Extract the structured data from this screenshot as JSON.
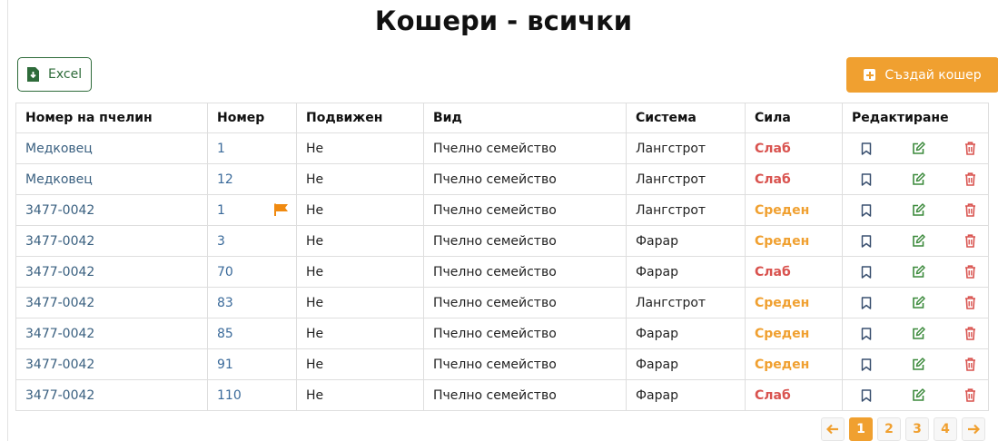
{
  "page": {
    "title": "Кошери - всички"
  },
  "toolbar": {
    "excel_label": "Excel",
    "create_label": "Създай кошер"
  },
  "table": {
    "headers": [
      "Номер на пчелин",
      "Номер",
      "Подвижен",
      "Вид",
      "Система",
      "Сила",
      "Редактиране"
    ],
    "rows": [
      {
        "apiary": "Медковец",
        "number": "1",
        "flag": false,
        "mobile": "Не",
        "type": "Пчелно семейство",
        "system": "Лангстрот",
        "strength": "Слаб",
        "level": "weak"
      },
      {
        "apiary": "Медковец",
        "number": "12",
        "flag": false,
        "mobile": "Не",
        "type": "Пчелно семейство",
        "system": "Лангстрот",
        "strength": "Слаб",
        "level": "weak"
      },
      {
        "apiary": "3477-0042",
        "number": "1",
        "flag": true,
        "mobile": "Не",
        "type": "Пчелно семейство",
        "system": "Лангстрот",
        "strength": "Среден",
        "level": "mid"
      },
      {
        "apiary": "3477-0042",
        "number": "3",
        "flag": false,
        "mobile": "Не",
        "type": "Пчелно семейство",
        "system": "Фарар",
        "strength": "Среден",
        "level": "mid"
      },
      {
        "apiary": "3477-0042",
        "number": "70",
        "flag": false,
        "mobile": "Не",
        "type": "Пчелно семейство",
        "system": "Фарар",
        "strength": "Слаб",
        "level": "weak"
      },
      {
        "apiary": "3477-0042",
        "number": "83",
        "flag": false,
        "mobile": "Не",
        "type": "Пчелно семейство",
        "system": "Лангстрот",
        "strength": "Среден",
        "level": "mid"
      },
      {
        "apiary": "3477-0042",
        "number": "85",
        "flag": false,
        "mobile": "Не",
        "type": "Пчелно семейство",
        "system": "Фарар",
        "strength": "Среден",
        "level": "mid"
      },
      {
        "apiary": "3477-0042",
        "number": "91",
        "flag": false,
        "mobile": "Не",
        "type": "Пчелно семейство",
        "system": "Фарар",
        "strength": "Среден",
        "level": "mid"
      },
      {
        "apiary": "3477-0042",
        "number": "110",
        "flag": false,
        "mobile": "Не",
        "type": "Пчелно семейство",
        "system": "Фарар",
        "strength": "Слаб",
        "level": "weak"
      }
    ]
  },
  "pagination": {
    "pages": [
      "1",
      "2",
      "3",
      "4"
    ],
    "current": "1"
  },
  "colors": {
    "accent": "#f0a030",
    "weak": "#d9534f",
    "excel": "#2e6b3a",
    "link": "#3a6080"
  },
  "icons": {
    "excel": "file-excel-icon",
    "create": "plus-square-icon",
    "flag": "flag-icon",
    "bookmark": "bookmark-icon",
    "edit": "edit-icon",
    "delete": "trash-icon",
    "prev": "arrow-left-icon",
    "next": "arrow-right-icon"
  }
}
